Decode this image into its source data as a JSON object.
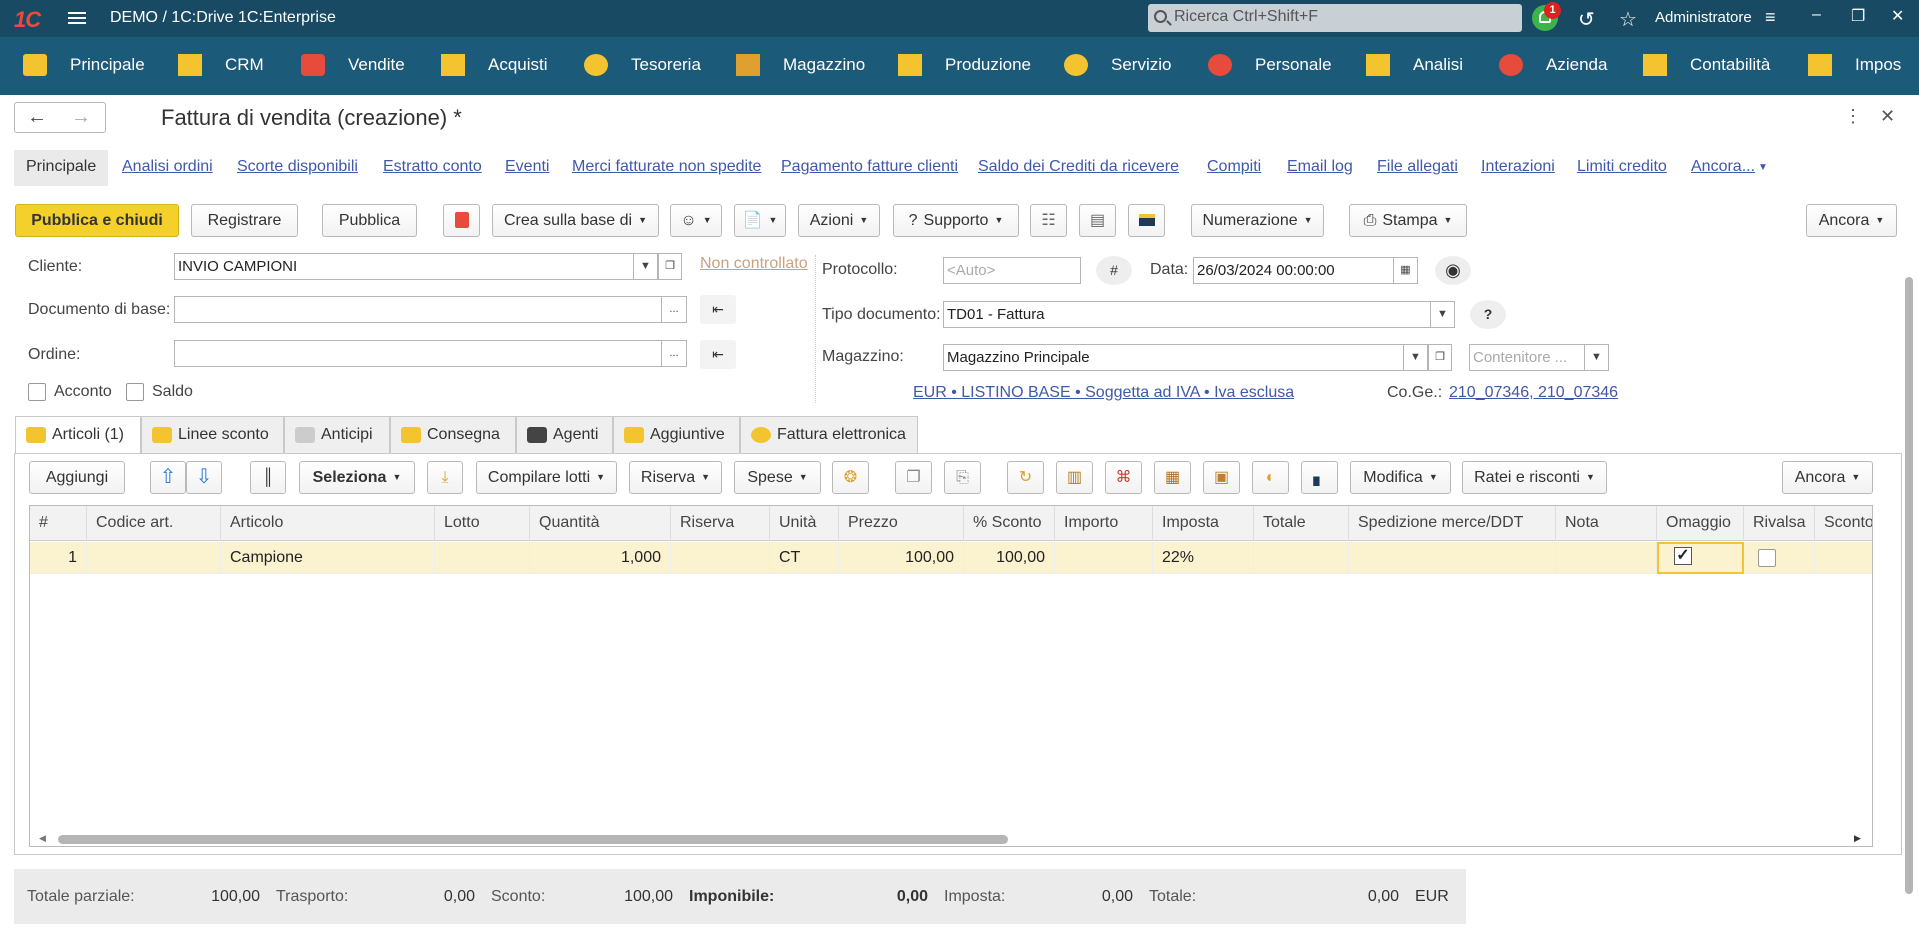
{
  "app": {
    "logo": "1C",
    "title": "DEMO / 1C:Drive 1C:Enterprise",
    "search_placeholder": "Ricerca Ctrl+Shift+F",
    "notifications": "1",
    "user": "Administratore"
  },
  "nav": [
    "Principale",
    "CRM",
    "Vendite",
    "Acquisti",
    "Tesoreria",
    "Magazzino",
    "Produzione",
    "Servizio",
    "Personale",
    "Analisi",
    "Azienda",
    "Contabilità",
    "Impos"
  ],
  "doc": {
    "title": "Fattura di vendita (creazione) *"
  },
  "tabs": [
    "Principale",
    "Analisi ordini",
    "Scorte disponibili",
    "Estratto conto",
    "Eventi",
    "Merci fatturate non spedite",
    "Pagamento fatture clienti",
    "Saldo dei Crediti  da ricevere",
    "Compiti",
    "Email log",
    "File allegati",
    "Interazioni",
    "Limiti credito",
    "Ancora..."
  ],
  "toolbar": {
    "post_close": "Pubblica e chiudi",
    "save": "Registrare",
    "post": "Pubblica",
    "create_based": "Crea sulla base di",
    "actions": "Azioni",
    "support": "Supporto",
    "numbering": "Numerazione",
    "print": "Stampa",
    "more": "Ancora",
    "help_glyph": "?"
  },
  "form": {
    "customer_label": "Cliente:",
    "customer": "INVIO CAMPIONI",
    "not_controlled": "Non controllato",
    "base_doc_label": "Documento di base:",
    "base_doc": "",
    "order_label": "Ordine:",
    "order": "",
    "advance_label": "Acconto",
    "balance_label": "Saldo",
    "protocol_label": "Protocollo:",
    "protocol_placeholder": "<Auto>",
    "hash": "#",
    "date_label": "Data:",
    "date": "26/03/2024 00:00:00",
    "doctype_label": "Tipo documento:",
    "doctype": "TD01 - Fattura",
    "help": "?",
    "warehouse_label": "Magazzino:",
    "warehouse": "Magazzino Principale",
    "container_placeholder": "Contenitore ...",
    "price_info": "EUR • LISTINO BASE • Soggetta ad IVA • Iva esclusa",
    "coge_label": "Co.Ge.:",
    "coge": "210_07346, 210_07346",
    "ellipsis": "..."
  },
  "page_tabs": [
    "Articoli (1)",
    "Linee sconto",
    "Anticipi",
    "Consegna",
    "Agenti",
    "Aggiuntive",
    "Fattura elettronica"
  ],
  "grid_toolbar": {
    "add": "Aggiungi",
    "select": "Seleziona",
    "fill_lots": "Compilare lotti",
    "reserve": "Riserva",
    "expenses": "Spese",
    "modify": "Modifica",
    "accruals": "Ratei e risconti",
    "more": "Ancora"
  },
  "grid": {
    "columns": [
      "#",
      "Codice art.",
      "Articolo",
      "Lotto",
      "Quantità",
      "Riserva",
      "Unità",
      "Prezzo",
      "% Sconto",
      "Importo",
      "Imposta",
      "Totale",
      "Spedizione merce/DDT",
      "Nota",
      "Omaggio",
      "Rivalsa",
      "Sconto a"
    ],
    "rows": [
      {
        "n": "1",
        "code": "",
        "item": "Campione",
        "lot": "",
        "qty": "1,000",
        "reserve": "",
        "unit": "CT",
        "price": "100,00",
        "discount": "100,00",
        "amount": "",
        "tax": "22%",
        "total": "",
        "shipping": "",
        "note": "",
        "gift": true,
        "recharge": false
      }
    ]
  },
  "totals": {
    "subtotal_label": "Totale parziale:",
    "subtotal": "100,00",
    "transport_label": "Trasporto:",
    "transport": "0,00",
    "discount_label": "Sconto:",
    "discount": "100,00",
    "taxable_label": "Imponibile:",
    "taxable": "0,00",
    "tax_label": "Imposta:",
    "tax": "0,00",
    "total_label": "Totale:",
    "total": "0,00",
    "currency": "EUR"
  }
}
